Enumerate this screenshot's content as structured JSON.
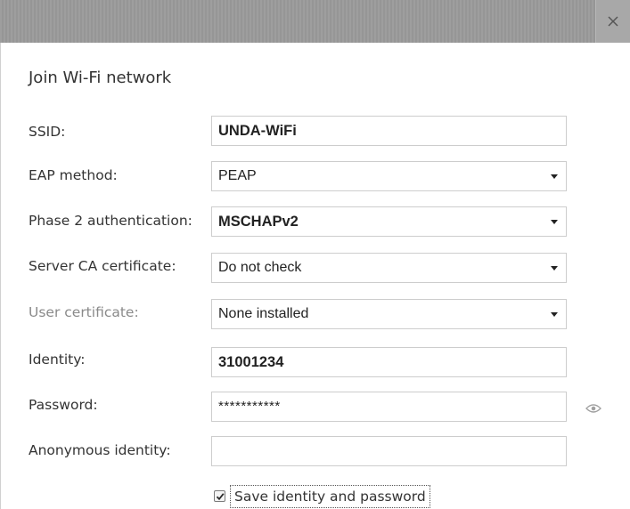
{
  "dialog": {
    "title": "Join Wi-Fi network",
    "close_icon": "close-icon"
  },
  "form": {
    "ssid": {
      "label": "SSID:",
      "value": "UNDA-WiFi"
    },
    "eap_method": {
      "label": "EAP method:",
      "value": "PEAP"
    },
    "phase2": {
      "label": "Phase 2 authentication:",
      "value": "MSCHAPv2"
    },
    "server_ca": {
      "label": "Server CA certificate:",
      "value": "Do not check"
    },
    "user_cert": {
      "label": "User certificate:",
      "value": "None installed"
    },
    "identity": {
      "label": "Identity:",
      "value": "31001234"
    },
    "password": {
      "label": "Password:",
      "value": "***********",
      "show_icon": "eye-icon"
    },
    "anonymous_identity": {
      "label": "Anonymous identity:",
      "value": ""
    },
    "save_identity": {
      "label": "Save identity and password",
      "checked": true
    }
  },
  "colors": {
    "titlebar": "#9b9b9b",
    "text": "#333333",
    "disabled_text": "#8a8a8a",
    "field_border": "#cdcdcd"
  }
}
